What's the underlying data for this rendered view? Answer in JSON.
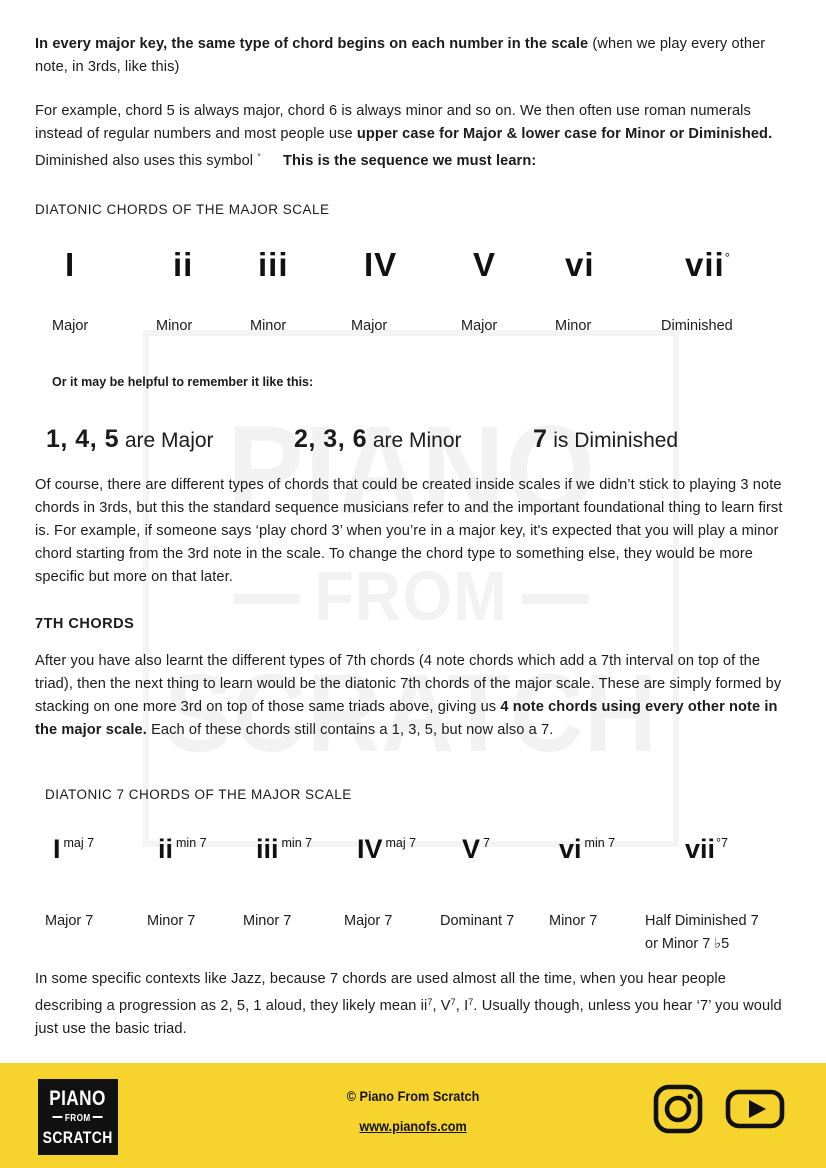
{
  "document": {
    "intro_1": {
      "bold_lead": "In every major key, the same type of chord begins on each number in the scale",
      "rest": " (when we play every other note, in 3rds, like this)"
    },
    "intro_2": {
      "part_a": "For example, chord 5 is always major, chord 6 is always minor and so on. We then often use roman numerals instead of regular numbers and most people use ",
      "bold_b": "upper case for Major & lower case for Minor or Diminished.",
      "part_c": " Diminished also uses this symbol ",
      "symbol": "°",
      "bold_d": "This is the sequence we must learn:"
    },
    "triad_heading": "DIATONIC CHORDS OF THE MAJOR SCALE",
    "triads": [
      {
        "numeral": "I",
        "degree_symbol": "",
        "quality": "Major"
      },
      {
        "numeral": "ii",
        "degree_symbol": "",
        "quality": "Minor"
      },
      {
        "numeral": "iii",
        "degree_symbol": "",
        "quality": "Minor"
      },
      {
        "numeral": "IV",
        "degree_symbol": "",
        "quality": "Major"
      },
      {
        "numeral": "V",
        "degree_symbol": "",
        "quality": "Major"
      },
      {
        "numeral": "vi",
        "degree_symbol": "",
        "quality": "Minor"
      },
      {
        "numeral": "vii",
        "degree_symbol": "°",
        "quality": "Diminished"
      }
    ],
    "mnemonic_note": "Or it may be helpful to remember it like this:",
    "mnemonics": [
      {
        "numbers": "1, 4, 5",
        "text": " are Major"
      },
      {
        "numbers": "2, 3, 6",
        "text": " are Minor"
      },
      {
        "numbers": "7",
        "text": " is Diminished"
      }
    ],
    "paragraph_of_course": "Of course, there are different types of chords that could be created inside scales if we didn’t stick to playing 3 note chords in 3rds, but this the standard sequence musicians refer to and the important foundational thing to learn first is. For example, if someone says ‘play chord 3’ when you’re in a major key, it's expected that you will play a minor chord starting from the 3rd note in the scale. To change the chord type to something else, they would be more specific but more on that later.",
    "seventh_heading": "7TH CHORDS",
    "paragraph_seventh": {
      "part_a": "After you have also learnt the different types of 7th chords (4 note chords which add a 7th interval on top of the triad), then the next thing to learn would be the diatonic 7th chords of the major scale. These are simply formed by stacking on one more 3rd on top of those same triads above, giving us ",
      "bold_b": "4 note chords using every other note in the major scale.",
      "part_c": " Each of these chords still contains a 1, 3, 5, but now also a 7."
    },
    "seventh_chart_heading": "DIATONIC 7 CHORDS OF THE MAJOR SCALE",
    "sevenths": [
      {
        "numeral": "I",
        "extension": "maj 7",
        "quality": "Major 7",
        "quality_2": ""
      },
      {
        "numeral": "ii",
        "extension": "min 7",
        "quality": "Minor 7",
        "quality_2": ""
      },
      {
        "numeral": "iii",
        "extension": "min 7",
        "quality": "Minor 7",
        "quality_2": ""
      },
      {
        "numeral": "IV",
        "extension": "maj 7",
        "quality": "Major 7",
        "quality_2": ""
      },
      {
        "numeral": "V",
        "extension": "7",
        "quality": "Dominant 7",
        "quality_2": ""
      },
      {
        "numeral": "vi",
        "extension": "min 7",
        "quality": "Minor 7",
        "quality_2": ""
      },
      {
        "numeral": "vii",
        "extension": "°7",
        "quality": "Half Diminished 7",
        "quality_2": "or  Minor 7 ♭5"
      }
    ],
    "paragraph_jazz": "In some specific contexts like Jazz, because 7 chords are used almost all the time, when you hear people describing a progression as 2, 5, 1 aloud, they likely mean ii7, V7, I7. Usually though, unless you hear ‘7’ you would just use the basic triad.",
    "paragraph_jazz_parts": {
      "a": "In some specific contexts like Jazz, because 7 chords are used almost all the time, when you hear people describing a progression as 2, 5, 1 aloud, they likely mean ii",
      "sup1": "7",
      "b": ", V",
      "sup2": "7",
      "c": ", I",
      "sup3": "7",
      "d": ". Usually though, unless you hear ‘7’ you would just use the basic triad."
    }
  },
  "watermark": {
    "line1": "PIANO",
    "line2": "FROM",
    "line3": "SCRATCH"
  },
  "footer": {
    "logo": {
      "line1": "PIANO",
      "line2": "FROM",
      "line3": "SCRATCH"
    },
    "copyright": "© Piano From Scratch",
    "website": "www.pianofs.com",
    "social": [
      {
        "name": "instagram-icon"
      },
      {
        "name": "youtube-icon"
      }
    ],
    "background_color": "#f6d32d"
  }
}
